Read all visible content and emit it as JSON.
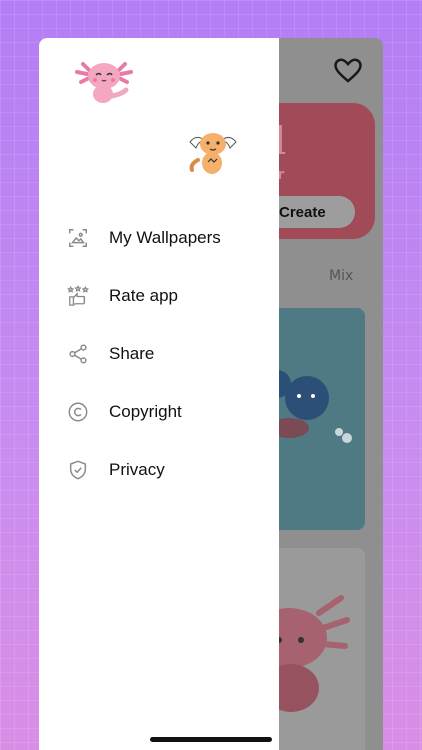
{
  "header": {
    "favorite_icon": "heart-icon"
  },
  "banner": {
    "title": "ll",
    "subtitle": "ker",
    "button_label": "Create"
  },
  "filters": {
    "mix_label": "Mix"
  },
  "drawer": {
    "items": [
      {
        "label": "My Wallpapers",
        "icon": "wallpaper-icon"
      },
      {
        "label": "Rate app",
        "icon": "rate-app-icon"
      },
      {
        "label": "Share",
        "icon": "share-icon"
      },
      {
        "label": "Copyright",
        "icon": "copyright-icon"
      },
      {
        "label": "Privacy",
        "icon": "shield-check-icon"
      }
    ]
  },
  "colors": {
    "background_top": "#b37ef5",
    "background_bottom": "#d98ee6",
    "banner": "#a04b57",
    "axolotl_pink": "#f3a7c0",
    "axolotl_orange": "#f5b06b"
  }
}
